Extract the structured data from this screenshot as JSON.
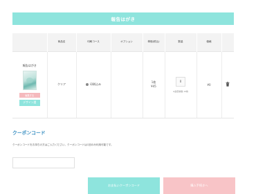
{
  "header": {
    "title": "報告はがき"
  },
  "table": {
    "headers": [
      "",
      "商品名",
      "印刷コース",
      "オプション",
      "単価(税込)",
      "数量",
      "価格",
      ""
    ],
    "row": {
      "product_label": "報告はがき",
      "edit_label": "編集する",
      "design_label": "デザイン選",
      "name": "クリア",
      "course": "印刷込み",
      "option": "",
      "unit_qty": "1枚",
      "unit_price": "¥45",
      "quantity": "0",
      "qty_note": "※最低枚数 10枚",
      "price": "¥0"
    }
  },
  "coupon": {
    "title": "クーポンコード",
    "description": "クーポンコードをお持ちの方はご入力ください。クーポンコードは1回のみ利用可能です。",
    "input_value": ""
  },
  "buttons": {
    "coupon_apply": "お支払いクーポンコード",
    "purchase": "購入手続きへ"
  },
  "colors": {
    "accent_teal": "#8ee4dd",
    "accent_pink": "#f8c4c7",
    "heading_blue": "#3a8fc2"
  }
}
